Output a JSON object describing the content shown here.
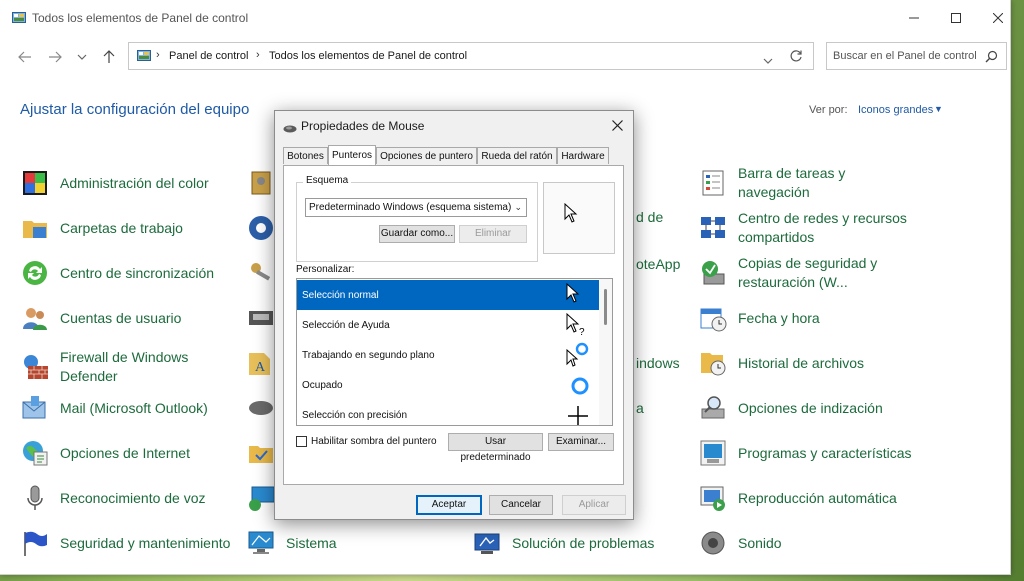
{
  "window": {
    "title": "Todos los elementos de Panel de control",
    "minimize": "–",
    "maximize": "☐",
    "close": "✕"
  },
  "address": {
    "crumbs": [
      "Panel de control",
      "Todos los elementos de Panel de control"
    ],
    "separator": "›"
  },
  "search": {
    "placeholder": "Buscar en el Panel de control"
  },
  "page": {
    "heading": "Ajustar la configuración del equipo",
    "view_by_label": "Ver por:",
    "view_by_value": "Iconos grandes"
  },
  "items": {
    "col1": [
      {
        "label": "Administración del color",
        "icon": "color-management-icon"
      },
      {
        "label": "Carpetas de trabajo",
        "icon": "work-folders-icon"
      },
      {
        "label": "Centro de sincronización",
        "icon": "sync-center-icon"
      },
      {
        "label": "Cuentas de usuario",
        "icon": "user-accounts-icon"
      },
      {
        "label": "Firewall de Windows Defender",
        "icon": "firewall-icon"
      },
      {
        "label": "Mail (Microsoft Outlook)",
        "icon": "mail-icon"
      },
      {
        "label": "Opciones de Internet",
        "icon": "internet-options-icon"
      },
      {
        "label": "Reconocimiento de voz",
        "icon": "microphone-icon"
      },
      {
        "label": "Seguridad y mantenimiento",
        "icon": "flag-icon"
      }
    ],
    "col2_partial": [
      {
        "label": "Sistema",
        "icon": "system-icon"
      }
    ],
    "col3_partial": [
      {
        "label": "d de",
        "icon": ""
      },
      {
        "label": "oteApp",
        "icon": ""
      },
      {
        "label": "indows",
        "icon": ""
      },
      {
        "label": "a",
        "icon": ""
      },
      {
        "label": "Solución de problemas",
        "icon": "troubleshooting-icon"
      }
    ],
    "col4": [
      {
        "label": "Barra de tareas y navegación",
        "icon": "taskbar-icon"
      },
      {
        "label": "Centro de redes y recursos compartidos",
        "icon": "network-icon"
      },
      {
        "label": "Copias de seguridad y restauración (W...",
        "icon": "backup-icon"
      },
      {
        "label": "Fecha y hora",
        "icon": "calendar-clock-icon"
      },
      {
        "label": "Historial de archivos",
        "icon": "file-history-icon"
      },
      {
        "label": "Opciones de indización",
        "icon": "indexing-icon"
      },
      {
        "label": "Programas y características",
        "icon": "programs-icon"
      },
      {
        "label": "Reproducción automática",
        "icon": "autoplay-icon"
      },
      {
        "label": "Sonido",
        "icon": "speaker-icon"
      }
    ]
  },
  "dialog": {
    "title": "Propiedades de Mouse",
    "tabs": [
      "Botones",
      "Punteros",
      "Opciones de puntero",
      "Rueda del ratón",
      "Hardware"
    ],
    "active_tab": "Punteros",
    "scheme_label": "Esquema",
    "scheme_value": "Predeterminado Windows (esquema sistema)",
    "save_as": "Guardar como...",
    "delete": "Eliminar",
    "customize_label": "Personalizar:",
    "pointers": [
      {
        "label": "Selección normal",
        "icon": "arrow-cursor-icon",
        "selected": true
      },
      {
        "label": "Selección de Ayuda",
        "icon": "help-cursor-icon",
        "selected": false
      },
      {
        "label": "Trabajando en segundo plano",
        "icon": "working-cursor-icon",
        "selected": false
      },
      {
        "label": "Ocupado",
        "icon": "busy-cursor-icon",
        "selected": false
      },
      {
        "label": "Selección con precisión",
        "icon": "crosshair-cursor-icon",
        "selected": false
      }
    ],
    "shadow_label": "Habilitar sombra del puntero",
    "shadow_checked": false,
    "use_default": "Usar predeterminado",
    "browse": "Examinar...",
    "ok": "Aceptar",
    "cancel": "Cancelar",
    "apply": "Aplicar"
  },
  "colors": {
    "accent": "#0067c0",
    "link": "#1f5aa6",
    "item_text": "#1d6b3c"
  }
}
